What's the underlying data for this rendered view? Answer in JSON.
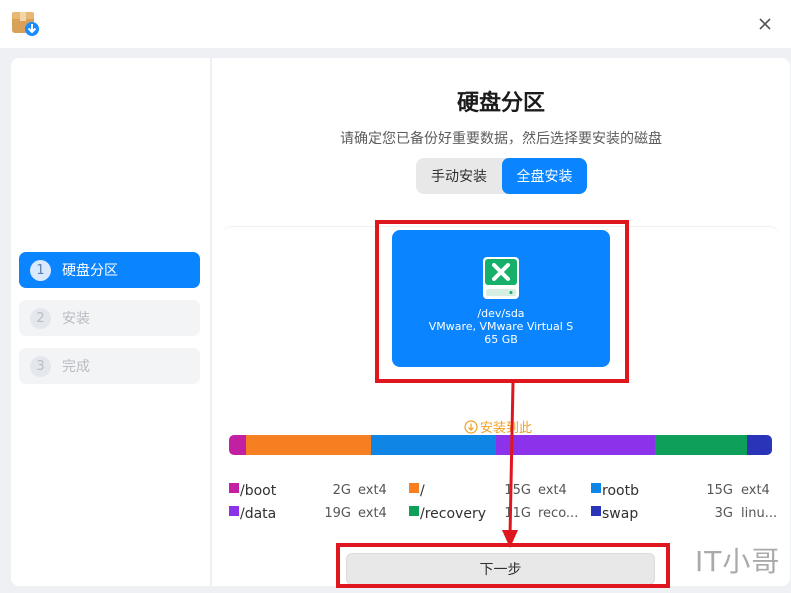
{
  "window": {
    "app_icon": "installer-box-icon",
    "close_icon": "close-icon"
  },
  "sidebar": {
    "steps": [
      {
        "num": "1",
        "label": "硬盘分区",
        "active": true
      },
      {
        "num": "2",
        "label": "安装",
        "active": false
      },
      {
        "num": "3",
        "label": "完成",
        "active": false
      }
    ]
  },
  "main": {
    "title": "硬盘分区",
    "subtitle": "请确定您已备份好重要数据，然后选择要安装的磁盘",
    "mode_tabs": {
      "manual": "手动安装",
      "full": "全盘安装",
      "selected": "full"
    },
    "disk": {
      "icon": "disk-drive-icon",
      "device": "/dev/sda",
      "model": "VMware, VMware Virtual S",
      "size": "65 GB"
    },
    "install_here": "安装到此",
    "install_here_icon": "down-arrow-circle-icon",
    "partitions": [
      {
        "name": "/boot",
        "size": "2G",
        "fs": "ext4",
        "color": "#c21fa3",
        "size_gb": 2
      },
      {
        "name": "/",
        "size": "15G",
        "fs": "ext4",
        "color": "#f57f21",
        "size_gb": 15
      },
      {
        "name": "rootb",
        "size": "15G",
        "fs": "ext4",
        "color": "#0f86e6",
        "size_gb": 15
      },
      {
        "name": "/data",
        "size": "19G",
        "fs": "ext4",
        "color": "#8b32ea",
        "size_gb": 19
      },
      {
        "name": "/recovery",
        "size": "11G",
        "fs": "reco...",
        "color": "#0ea05a",
        "size_gb": 11
      },
      {
        "name": "swap",
        "size": "3G",
        "fs": "linu...",
        "color": "#2a34b8",
        "size_gb": 3
      }
    ],
    "next_button": "下一步"
  },
  "watermark": "IT小哥",
  "colors": {
    "accent": "#0a84ff",
    "annotation": "#e0161e",
    "warning": "#f0a020"
  }
}
